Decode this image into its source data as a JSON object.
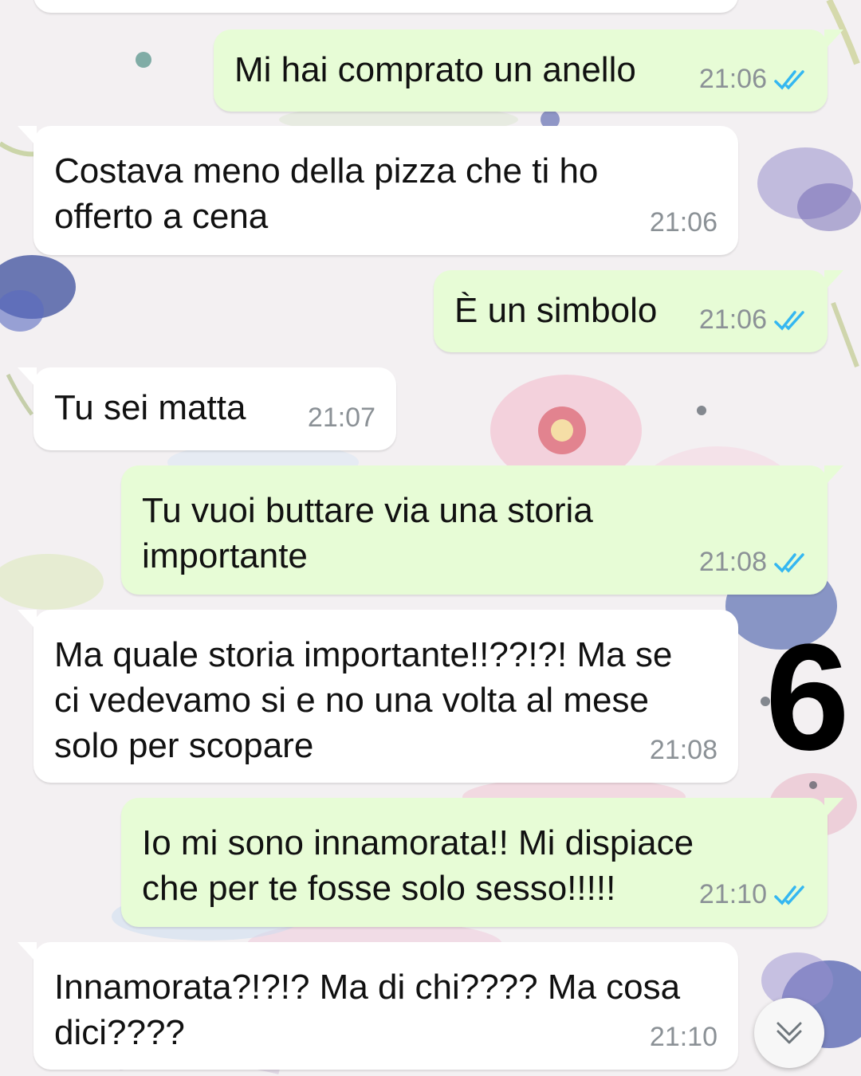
{
  "chat": {
    "messages": [
      {
        "direction": "out",
        "text": "Mi hai comprato un anello",
        "time": "21:06",
        "status": "read"
      },
      {
        "direction": "in",
        "text": "Costava meno della pizza che ti ho\nofferto a cena",
        "time": "21:06"
      },
      {
        "direction": "out",
        "text": "È un simbolo",
        "time": "21:06",
        "status": "read"
      },
      {
        "direction": "in",
        "text": "Tu sei matta",
        "time": "21:07"
      },
      {
        "direction": "out",
        "text": "Tu vuoi buttare via una storia\nimportante",
        "time": "21:08",
        "status": "read"
      },
      {
        "direction": "in",
        "text": "Ma quale storia importante!!??!?! Ma se\nci vedevamo si e no una volta al mese\nsolo per scopare",
        "time": "21:08"
      },
      {
        "direction": "out",
        "text": "Io mi sono innamorata!! Mi dispiace\nche per te fosse solo sesso!!!!!",
        "time": "21:10",
        "status": "read"
      },
      {
        "direction": "in",
        "text": "Innamorata?!?!? Ma di chi???? Ma cosa\ndici????",
        "time": "21:10"
      }
    ]
  },
  "overlay": {
    "page_number": "6"
  },
  "icons": {
    "read_receipt": "double-check-icon",
    "scroll_down": "chevron-double-down-icon"
  },
  "colors": {
    "incoming_bubble": "#ffffff",
    "outgoing_bubble": "#e7fcd6",
    "read_tick": "#34b7f1",
    "timestamp": "#8b9196"
  }
}
